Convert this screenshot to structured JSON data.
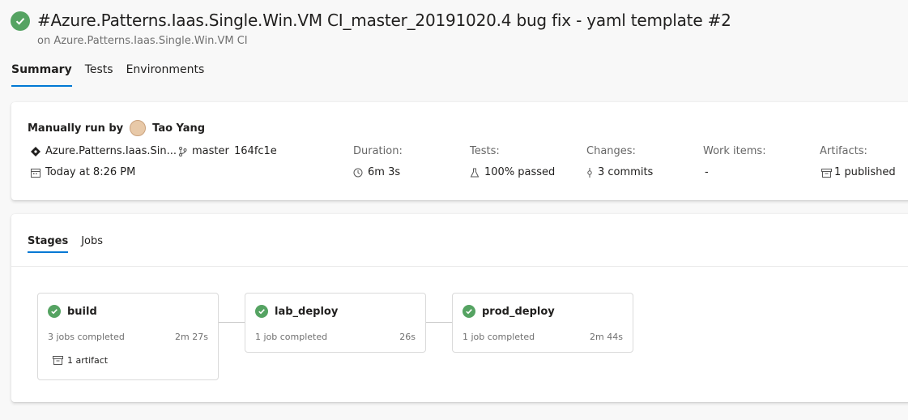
{
  "header": {
    "title": "#Azure.Patterns.Iaas.Single.Win.VM CI_master_20191020.4 bug fix - yaml template #2",
    "subtitle": "on Azure.Patterns.Iaas.Single.Win.VM CI"
  },
  "tabs": [
    {
      "label": "Summary",
      "active": true
    },
    {
      "label": "Tests",
      "active": false
    },
    {
      "label": "Environments",
      "active": false
    }
  ],
  "summary": {
    "run_by_label": "Manually run by",
    "user_name": "Tao Yang",
    "repo": "Azure.Patterns.Iaas.Sin...",
    "branch": "master",
    "commit": "164fc1e",
    "time": "Today at 8:26 PM",
    "duration": {
      "label": "Duration:",
      "value": "6m 3s"
    },
    "tests": {
      "label": "Tests:",
      "value": "100% passed"
    },
    "changes": {
      "label": "Changes:",
      "value": "3 commits"
    },
    "work_items": {
      "label": "Work items:",
      "value": "-"
    },
    "artifacts": {
      "label": "Artifacts:",
      "value": "1 published"
    }
  },
  "stage_tabs": [
    {
      "label": "Stages",
      "active": true
    },
    {
      "label": "Jobs",
      "active": false
    }
  ],
  "stages": [
    {
      "name": "build",
      "jobs": "3 jobs completed",
      "duration": "2m 27s",
      "artifact": "1 artifact"
    },
    {
      "name": "lab_deploy",
      "jobs": "1 job completed",
      "duration": "26s"
    },
    {
      "name": "prod_deploy",
      "jobs": "1 job completed",
      "duration": "2m 44s"
    }
  ],
  "colors": {
    "success": "#55a362",
    "accent": "#0078d4"
  }
}
